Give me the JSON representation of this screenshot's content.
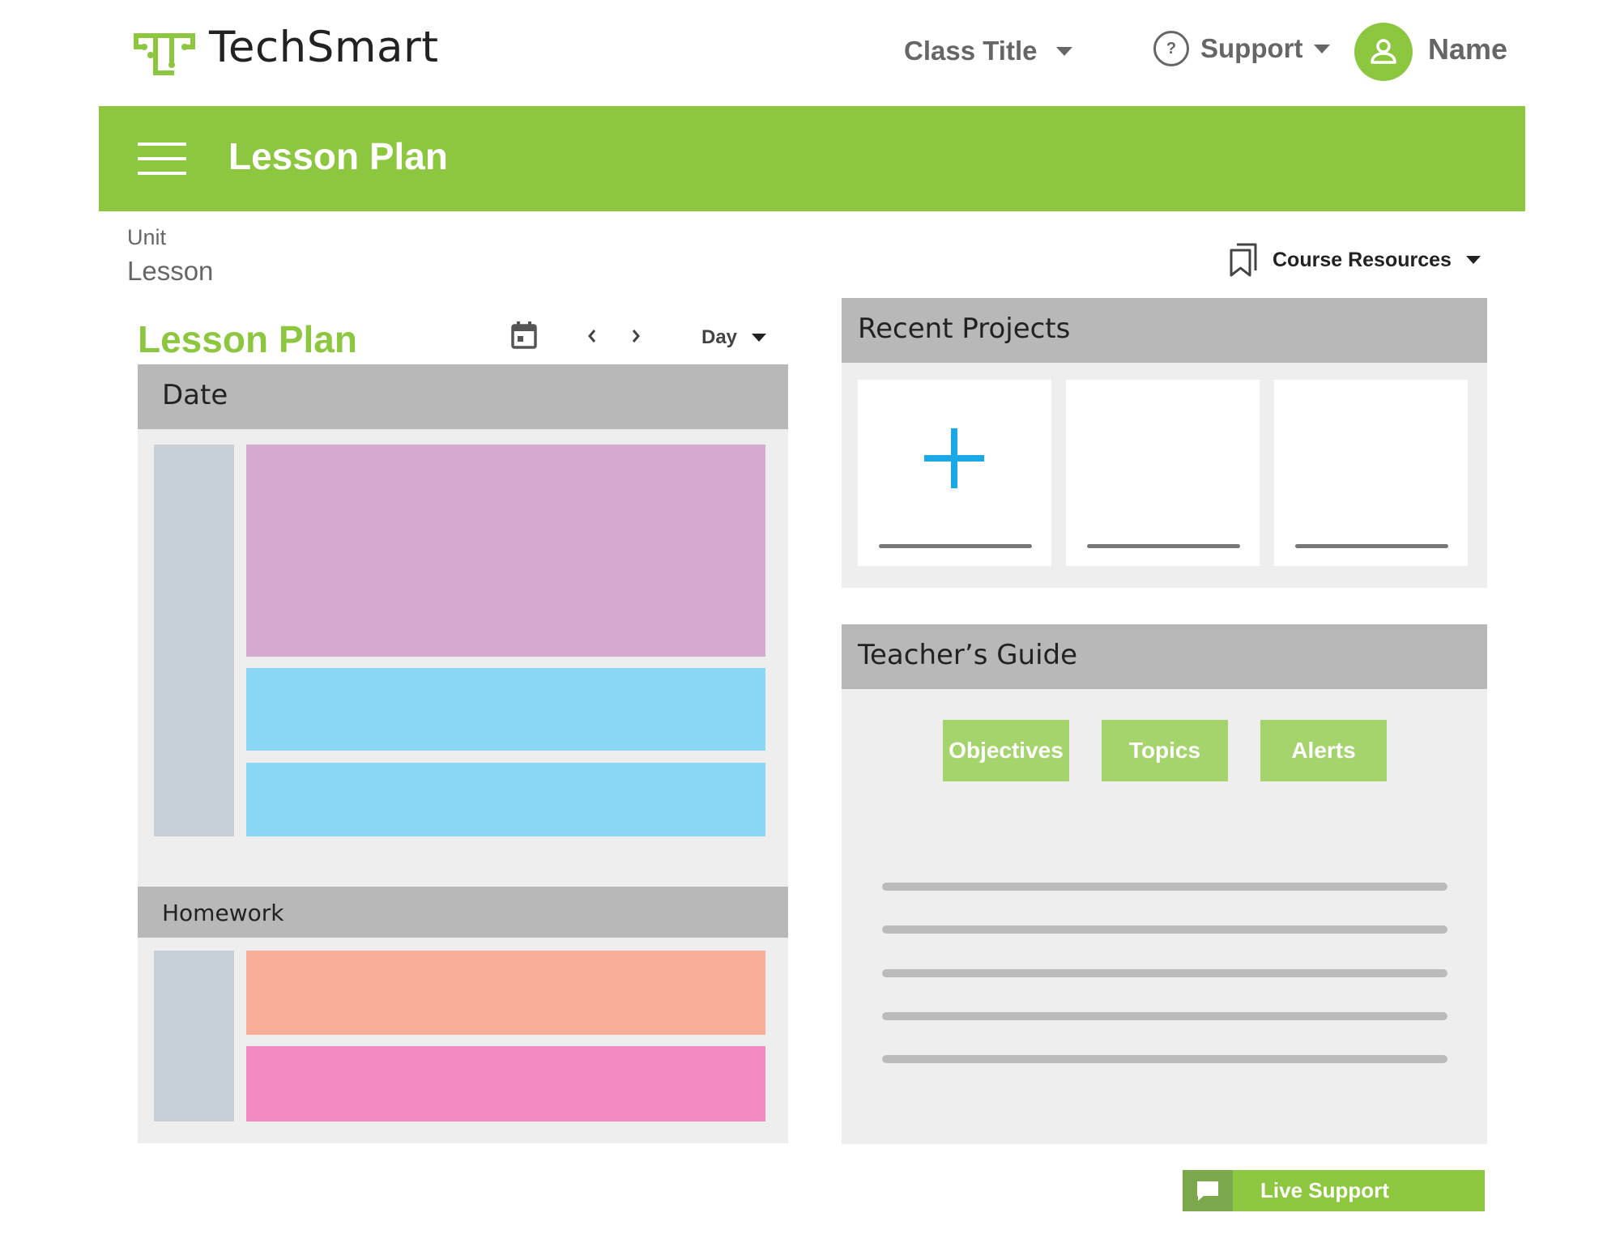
{
  "header": {
    "brand": "TechSmart",
    "class_title": "Class Title",
    "support_label": "Support",
    "support_icon_glyph": "?",
    "user_name": "Name"
  },
  "banner": {
    "title": "Lesson Plan"
  },
  "breadcrumb": {
    "unit": "Unit",
    "lesson": "Lesson"
  },
  "course_resources": {
    "label": "Course Resources"
  },
  "lesson_plan": {
    "heading": "Lesson Plan",
    "prev_glyph": "‹",
    "next_glyph": "›",
    "view_select": "Day",
    "date_header": "Date",
    "homework_header": "Homework"
  },
  "recent_projects": {
    "title": "Recent Projects",
    "new_project_icon": "plus-icon"
  },
  "teachers_guide": {
    "title": "Teacher’s Guide",
    "buttons": [
      "Objectives",
      "Topics",
      "Alerts"
    ]
  },
  "live_support": {
    "label": "Live Support"
  },
  "colors": {
    "brand_green": "#8dc63f",
    "button_green": "#a5d46d",
    "accent_blue": "#1aa8e6",
    "block_purple": "#d6a9d0",
    "block_blue": "#8bd8f6",
    "block_orange": "#f8ae98",
    "block_pink": "#f38bc2",
    "time_column": "#c7cfd7",
    "panel_bg": "#eeeeee",
    "panel_header": "#b8b8b8"
  }
}
